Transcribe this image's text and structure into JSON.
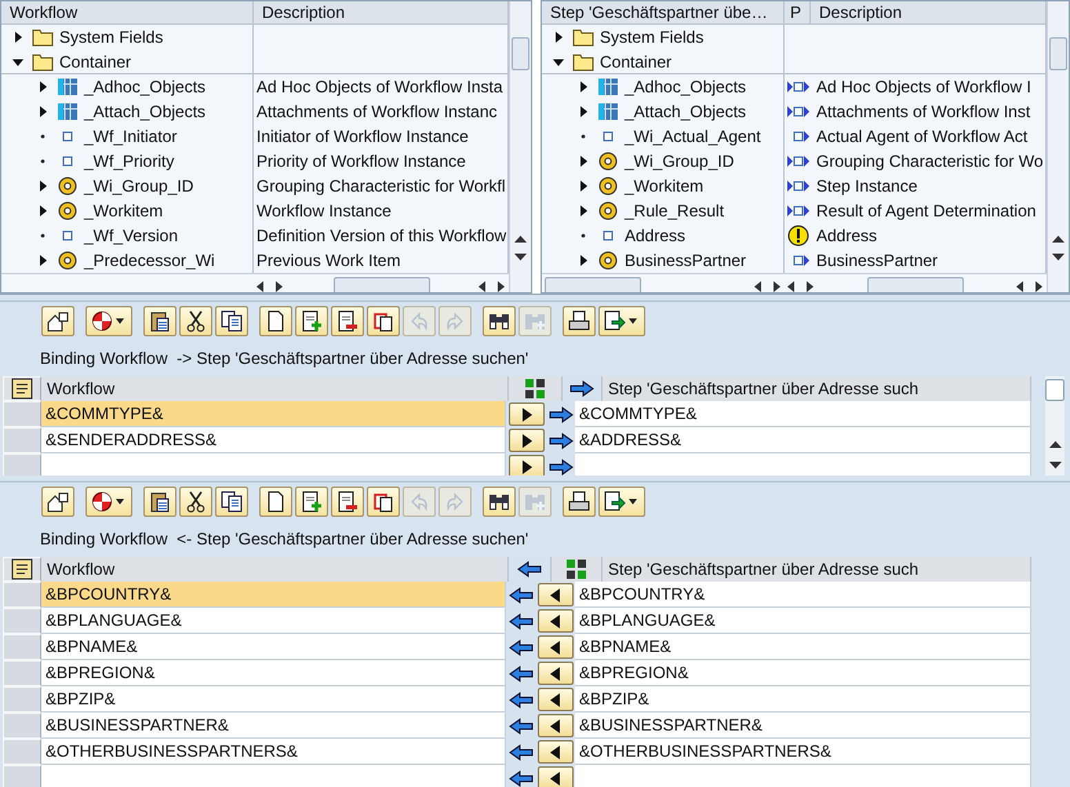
{
  "left_tree": {
    "columns": [
      "Workflow",
      "Description"
    ],
    "items": [
      {
        "label": "System Fields",
        "kind": "folder",
        "expanded": false
      },
      {
        "label": "Container",
        "kind": "folder",
        "expanded": true,
        "children": [
          {
            "label": "_Adhoc_Objects",
            "kind": "table",
            "expanded": false,
            "description": "Ad Hoc Objects of Workflow Insta"
          },
          {
            "label": "_Attach_Objects",
            "kind": "table",
            "expanded": false,
            "description": "Attachments of Workflow Instanc"
          },
          {
            "label": "_Wf_Initiator",
            "kind": "field",
            "description": "Initiator of Workflow Instance"
          },
          {
            "label": "_Wf_Priority",
            "kind": "field",
            "description": "Priority of Workflow Instance"
          },
          {
            "label": "_Wi_Group_ID",
            "kind": "object",
            "expanded": false,
            "description": "Grouping Characteristic for Workfl"
          },
          {
            "label": "_Workitem",
            "kind": "object",
            "expanded": false,
            "description": "Workflow Instance"
          },
          {
            "label": "_Wf_Version",
            "kind": "field",
            "description": "Definition Version of this Workflow"
          },
          {
            "label": "_Predecessor_Wi",
            "kind": "object",
            "expanded": false,
            "description": "Previous Work Item"
          }
        ]
      }
    ]
  },
  "right_tree": {
    "columns": [
      "Step 'Geschäftspartner übe…",
      "P",
      "Description"
    ],
    "items": [
      {
        "label": "System Fields",
        "kind": "folder",
        "expanded": false
      },
      {
        "label": "Container",
        "kind": "folder",
        "expanded": true,
        "children": [
          {
            "label": "_Adhoc_Objects",
            "kind": "table",
            "expanded": false,
            "binding": {
              "kind": "import_export"
            },
            "description": "Ad Hoc Objects of Workflow I"
          },
          {
            "label": "_Attach_Objects",
            "kind": "table",
            "expanded": false,
            "binding": {
              "kind": "import_export"
            },
            "description": "Attachments of Workflow Inst"
          },
          {
            "label": "_Wi_Actual_Agent",
            "kind": "field",
            "binding": {
              "kind": "export"
            },
            "description": "Actual Agent of Workflow Act"
          },
          {
            "label": "_Wi_Group_ID",
            "kind": "object",
            "expanded": false,
            "binding": {
              "kind": "import_export"
            },
            "description": "Grouping Characteristic for Wo"
          },
          {
            "label": "_Workitem",
            "kind": "object",
            "expanded": false,
            "binding": {
              "kind": "import_export"
            },
            "description": "Step Instance"
          },
          {
            "label": "_Rule_Result",
            "kind": "object",
            "expanded": false,
            "binding": {
              "kind": "import_export"
            },
            "description": "Result of Agent Determination"
          },
          {
            "label": "Address",
            "kind": "field",
            "binding": {
              "kind": "warning"
            },
            "description": "Address"
          },
          {
            "label": "BusinessPartner",
            "kind": "object",
            "expanded": false,
            "binding": {
              "kind": "export"
            },
            "description": "BusinessPartner"
          }
        ]
      }
    ]
  },
  "bindings": [
    {
      "kind": "to_step",
      "caption": "Binding Workflow  -> Step 'Geschäftspartner über Adresse suchen'",
      "columns": [
        "Workflow",
        "Step 'Geschäftspartner über Adresse such"
      ],
      "toolbar": [
        {
          "kind": "details",
          "disabled": false,
          "menu": false
        },
        {
          "kind": "check",
          "disabled": false,
          "menu": true
        },
        {
          "kind": "paste",
          "disabled": false,
          "menu": false
        },
        {
          "kind": "cut",
          "disabled": false,
          "menu": false
        },
        {
          "kind": "copy",
          "disabled": false,
          "menu": false
        },
        {
          "kind": "new",
          "disabled": false,
          "menu": false
        },
        {
          "kind": "insert",
          "disabled": false,
          "menu": false
        },
        {
          "kind": "delete",
          "disabled": false,
          "menu": false
        },
        {
          "kind": "duplicate",
          "disabled": false,
          "menu": false
        },
        {
          "kind": "undo",
          "disabled": true,
          "menu": false
        },
        {
          "kind": "redo",
          "disabled": true,
          "menu": false
        },
        {
          "kind": "find",
          "disabled": false,
          "menu": false
        },
        {
          "kind": "find_next",
          "disabled": true,
          "menu": false
        },
        {
          "kind": "print",
          "disabled": false,
          "menu": false
        },
        {
          "kind": "export",
          "disabled": false,
          "menu": true
        }
      ],
      "rows": [
        {
          "workflow": "&COMMTYPE&",
          "step": "&COMMTYPE&",
          "selected": true
        },
        {
          "workflow": "&SENDERADDRESS&",
          "step": "&ADDRESS&",
          "selected": false
        }
      ]
    },
    {
      "kind": "to_workflow",
      "caption": "Binding Workflow  <- Step 'Geschäftspartner über Adresse suchen'",
      "columns": [
        "Workflow",
        "Step 'Geschäftspartner über Adresse such"
      ],
      "toolbar": [
        {
          "kind": "details",
          "disabled": false,
          "menu": false
        },
        {
          "kind": "check",
          "disabled": false,
          "menu": true
        },
        {
          "kind": "paste",
          "disabled": false,
          "menu": false
        },
        {
          "kind": "cut",
          "disabled": false,
          "menu": false
        },
        {
          "kind": "copy",
          "disabled": false,
          "menu": false
        },
        {
          "kind": "new",
          "disabled": false,
          "menu": false
        },
        {
          "kind": "insert",
          "disabled": false,
          "menu": false
        },
        {
          "kind": "delete",
          "disabled": false,
          "menu": false
        },
        {
          "kind": "duplicate",
          "disabled": false,
          "menu": false
        },
        {
          "kind": "undo",
          "disabled": true,
          "menu": false
        },
        {
          "kind": "redo",
          "disabled": true,
          "menu": false
        },
        {
          "kind": "find",
          "disabled": false,
          "menu": false
        },
        {
          "kind": "find_next",
          "disabled": true,
          "menu": false
        },
        {
          "kind": "print",
          "disabled": false,
          "menu": false
        },
        {
          "kind": "export",
          "disabled": false,
          "menu": true
        }
      ],
      "rows": [
        {
          "workflow": "&BPCOUNTRY&",
          "step": "&BPCOUNTRY&",
          "selected": true
        },
        {
          "workflow": "&BPLANGUAGE&",
          "step": "&BPLANGUAGE&",
          "selected": false
        },
        {
          "workflow": "&BPNAME&",
          "step": "&BPNAME&",
          "selected": false
        },
        {
          "workflow": "&BPREGION&",
          "step": "&BPREGION&",
          "selected": false
        },
        {
          "workflow": "&BPZIP&",
          "step": "&BPZIP&",
          "selected": false
        },
        {
          "workflow": "&BUSINESSPARTNER&",
          "step": "&BUSINESSPARTNER&",
          "selected": false
        },
        {
          "workflow": "&OTHERBUSINESSPARTNERS&",
          "step": "&OTHERBUSINESSPARTNERS&",
          "selected": false
        }
      ]
    }
  ]
}
